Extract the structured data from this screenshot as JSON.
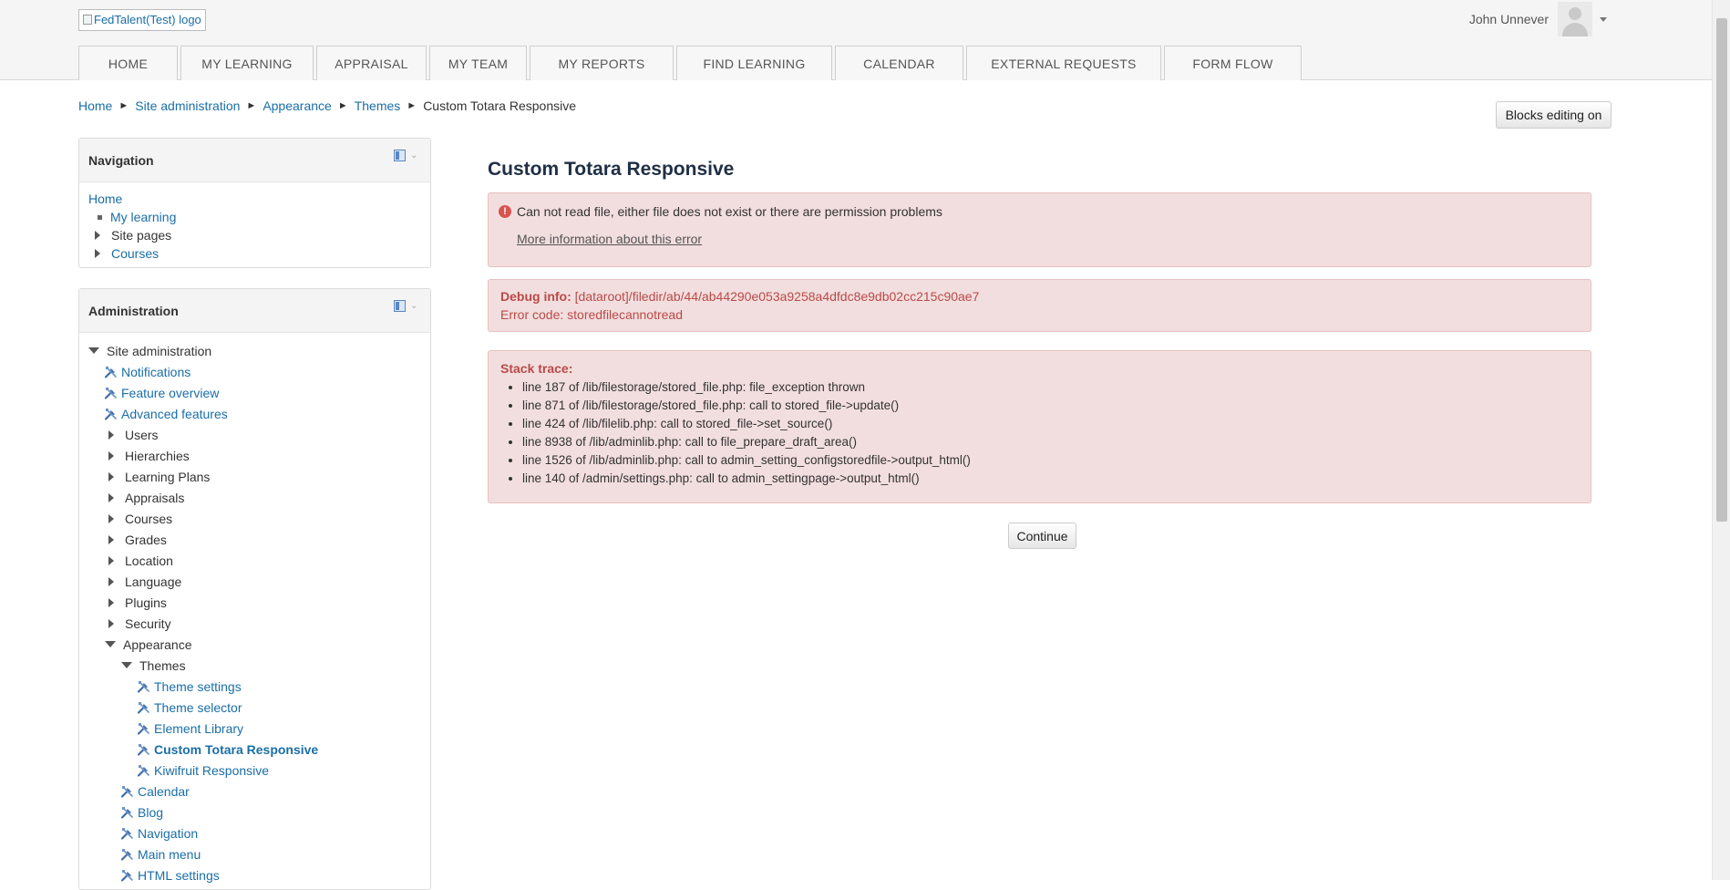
{
  "header": {
    "logo_alt": "FedTalent(Test) logo",
    "user_name": "John Unnever"
  },
  "topnav": [
    {
      "label": "HOME"
    },
    {
      "label": "MY LEARNING"
    },
    {
      "label": "APPRAISAL"
    },
    {
      "label": "MY TEAM"
    },
    {
      "label": "MY REPORTS"
    },
    {
      "label": "FIND LEARNING"
    },
    {
      "label": "CALENDAR"
    },
    {
      "label": "EXTERNAL REQUESTS"
    },
    {
      "label": "FORM FLOW"
    }
  ],
  "breadcrumb": [
    "Home",
    "Site administration",
    "Appearance",
    "Themes",
    "Custom Totara Responsive"
  ],
  "breadcrumb_separator": "►",
  "blocks_editing_label": "Blocks editing on",
  "navigation_block": {
    "title": "Navigation",
    "home": "Home",
    "items": [
      {
        "label": "My learning",
        "type": "bullet"
      },
      {
        "label": "Site pages",
        "type": "collapsed"
      },
      {
        "label": "Courses",
        "type": "collapsed-link"
      }
    ]
  },
  "administration_block": {
    "title": "Administration",
    "root": "Site administration",
    "items": [
      {
        "label": "Notifications",
        "icon": "wrench-icon"
      },
      {
        "label": "Feature overview",
        "icon": "wrench-icon"
      },
      {
        "label": "Advanced features",
        "icon": "wrench-icon"
      },
      {
        "label": "Users",
        "icon": "expand"
      },
      {
        "label": "Hierarchies",
        "icon": "expand"
      },
      {
        "label": "Learning Plans",
        "icon": "expand"
      },
      {
        "label": "Appraisals",
        "icon": "expand"
      },
      {
        "label": "Courses",
        "icon": "expand"
      },
      {
        "label": "Grades",
        "icon": "expand"
      },
      {
        "label": "Location",
        "icon": "expand"
      },
      {
        "label": "Language",
        "icon": "expand"
      },
      {
        "label": "Plugins",
        "icon": "expand"
      },
      {
        "label": "Security",
        "icon": "expand"
      },
      {
        "label": "Appearance",
        "icon": "expanded"
      },
      {
        "label": "Themes",
        "icon": "expanded"
      },
      {
        "label": "Theme settings",
        "icon": "wrench-icon"
      },
      {
        "label": "Theme selector",
        "icon": "wrench-icon"
      },
      {
        "label": "Element Library",
        "icon": "wrench-icon"
      },
      {
        "label": "Custom Totara Responsive",
        "icon": "wrench-icon",
        "active": true
      },
      {
        "label": "Kiwifruit Responsive",
        "icon": "wrench-icon"
      },
      {
        "label": "Calendar",
        "icon": "wrench-icon"
      },
      {
        "label": "Blog",
        "icon": "wrench-icon"
      },
      {
        "label": "Navigation",
        "icon": "wrench-icon"
      },
      {
        "label": "Main menu",
        "icon": "wrench-icon"
      },
      {
        "label": "HTML settings",
        "icon": "wrench-icon"
      }
    ]
  },
  "main": {
    "title": "Custom Totara Responsive",
    "error_message": "Can not read file, either file does not exist or there are permission problems",
    "more_info_link": "More information about this error",
    "debug_label": "Debug info:",
    "debug_value": "[dataroot]/filedir/ab/44/ab44290e053a9258a4dfdc8e9db02cc215c90ae7",
    "error_code": "Error code: storedfilecannotread",
    "stack_trace_title": "Stack trace:",
    "stack_trace": [
      "line 187 of /lib/filestorage/stored_file.php: file_exception thrown",
      "line 871 of /lib/filestorage/stored_file.php: call to stored_file->update()",
      "line 424 of /lib/filelib.php: call to stored_file->set_source()",
      "line 8938 of /lib/adminlib.php: call to file_prepare_draft_area()",
      "line 1526 of /lib/adminlib.php: call to admin_setting_configstoredfile->output_html()",
      "line 140 of /admin/settings.php: call to admin_settingpage->output_html()"
    ],
    "continue_label": "Continue"
  },
  "colors": {
    "link": "#1a6ea8",
    "alert_bg": "#f2dede",
    "alert_text": "#b94a48",
    "title": "#1f2f45"
  }
}
